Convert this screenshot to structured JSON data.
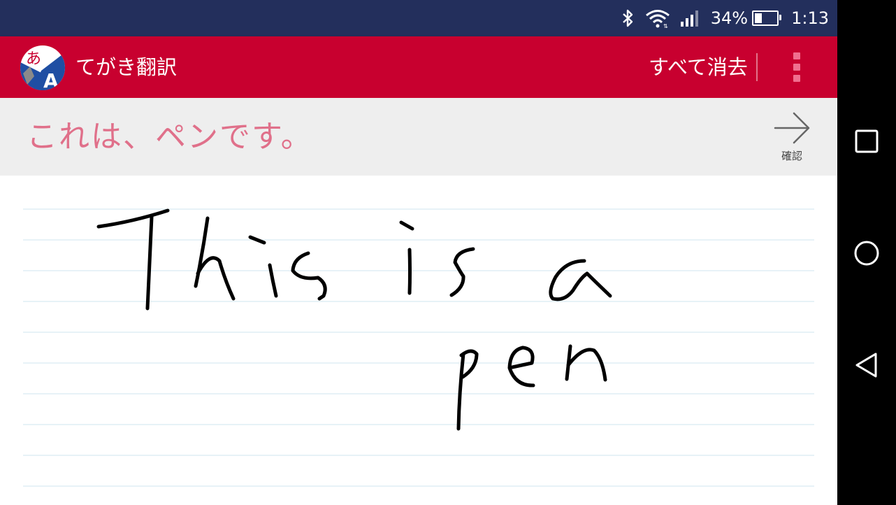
{
  "status_bar": {
    "battery_text": "34%",
    "battery_level": 0.34,
    "time": "1:13",
    "icons": [
      "bluetooth-icon",
      "wifi-icon",
      "signal-icon",
      "battery-icon"
    ]
  },
  "toolbar": {
    "app_icon": "app-logo-icon",
    "title": "てがき翻訳",
    "clear_all_label": "すべて消去",
    "overflow_icon": "more-vert-icon"
  },
  "result": {
    "text": "これは、ペンです。",
    "confirm_label": "確認",
    "confirm_icon": "arrow-right-icon"
  },
  "handwriting": {
    "words": [
      "This",
      "is",
      "a",
      "pen"
    ]
  },
  "navigation": {
    "icons": [
      "recents-icon",
      "home-icon",
      "back-icon"
    ]
  },
  "colors": {
    "status_bar": "#232f5c",
    "toolbar": "#c8002f",
    "result_text": "#e0708a",
    "ruled_line": "#cfe6ef",
    "ink": "#000000"
  }
}
